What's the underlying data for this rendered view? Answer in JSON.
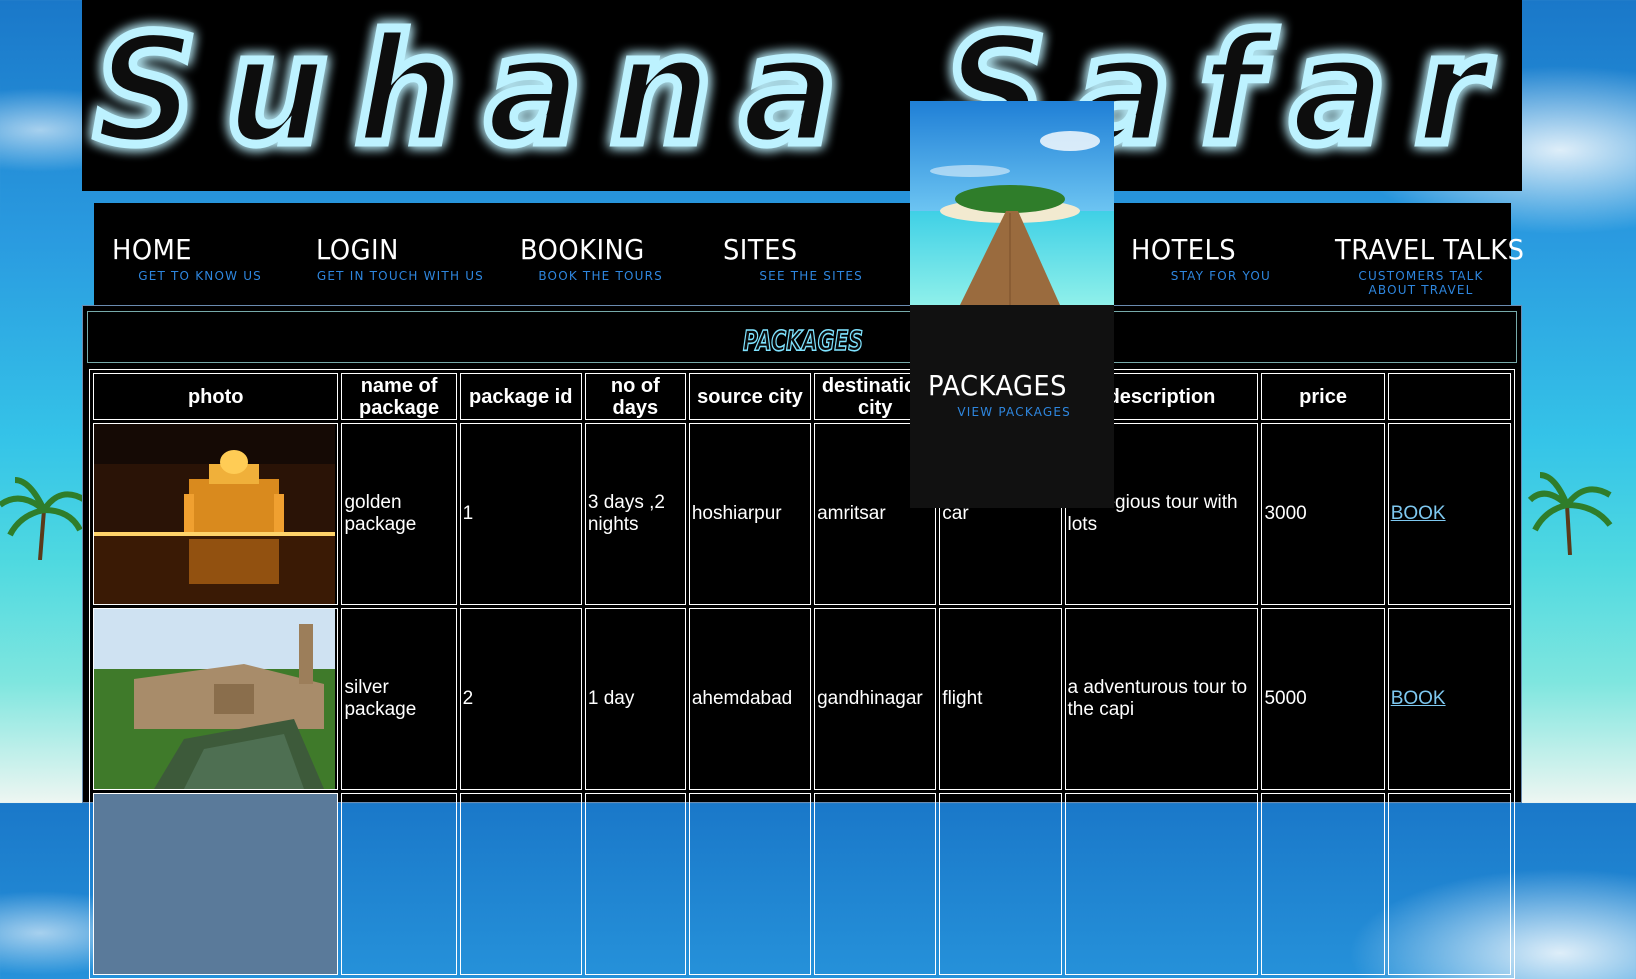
{
  "site": {
    "logo_text": "Suhana Safar"
  },
  "nav": {
    "items": [
      {
        "label": "HOME",
        "sub": "GET TO KNOW US"
      },
      {
        "label": "LOGIN",
        "sub": "GET IN TOUCH WITH US"
      },
      {
        "label": "BOOKING",
        "sub": "BOOK THE TOURS"
      },
      {
        "label": "SITES",
        "sub": "SEE THE SITES"
      },
      {
        "label": "HOTELS",
        "sub": "STAY FOR YOU"
      },
      {
        "label": "TRAVEL TALKS",
        "sub": "CUSTOMERS TALK ABOUT TRAVEL"
      }
    ],
    "dropdown": {
      "label": "PACKAGES",
      "sub": "VIEW PACKAGES"
    }
  },
  "page": {
    "title": "PACKAGES"
  },
  "table": {
    "headers": [
      "photo",
      "name of package",
      "package id",
      "no of days",
      "source city",
      "destination city",
      "",
      "description",
      "price",
      ""
    ],
    "rows": [
      {
        "name": "golden package",
        "id": "1",
        "days": "3 days ,2 nights",
        "source": "hoshiarpur",
        "destination": "amritsar",
        "mode": "car",
        "description": "a relegious tour with lots",
        "price": "3000",
        "action": "BOOK"
      },
      {
        "name": "silver package",
        "id": "2",
        "days": "1 day",
        "source": "ahemdabad",
        "destination": "gandhinagar",
        "mode": "flight",
        "description": "a adventurous tour to the capi",
        "price": "5000",
        "action": "BOOK"
      }
    ]
  },
  "colors": {
    "accent": "#2e86de",
    "link": "#7ec8f0",
    "glow": "#5fd0ff"
  }
}
